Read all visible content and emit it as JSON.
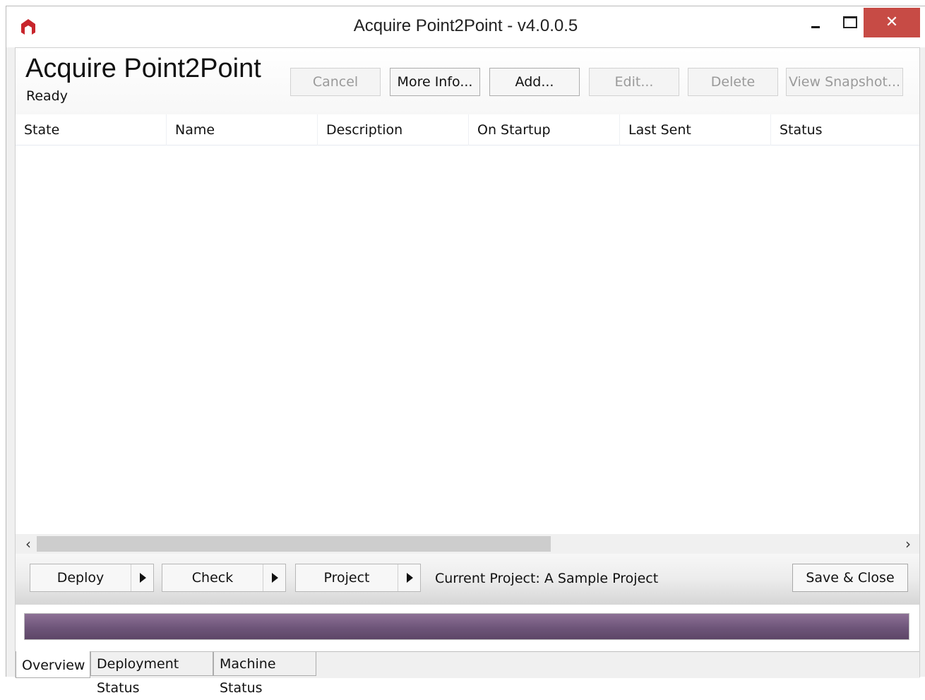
{
  "window": {
    "title": "Acquire Point2Point - v4.0.0.5",
    "close_glyph": "✕"
  },
  "header": {
    "app_name": "Acquire Point2Point",
    "status": "Ready"
  },
  "toolbar": {
    "cancel": "Cancel",
    "more_info": "More Info...",
    "add": "Add...",
    "edit": "Edit...",
    "delete": "Delete",
    "view_snapshot": "View Snapshot..."
  },
  "list": {
    "columns": [
      "State",
      "Name",
      "Description",
      "On Startup",
      "Last Sent",
      "Status"
    ],
    "rows": []
  },
  "scrollbar": {
    "left_glyph": "‹",
    "right_glyph": "›"
  },
  "bottom": {
    "deploy": "Deploy",
    "check": "Check",
    "project": "Project",
    "current_project": "Current Project: A Sample Project",
    "save_close": "Save & Close"
  },
  "progress": {
    "percent": 100,
    "color": "#6e5579"
  },
  "tabs": [
    "Overview",
    "Deployment Status",
    "Machine Status"
  ],
  "colors": {
    "close_button": "#c74b45",
    "logo": "#c8252c"
  },
  "icons": {
    "app": "acquire-logo-icon",
    "split_arrow": "triangle-right-icon"
  }
}
